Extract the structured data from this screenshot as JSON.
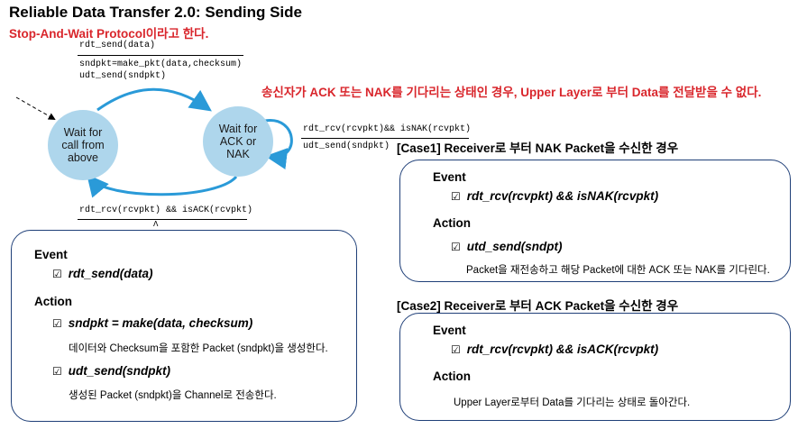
{
  "title": "Reliable Data Transfer 2.0: Sending Side",
  "subtitle": "Stop-And-Wait Protocol이라고 한다.",
  "note": "송신자가 ACK 또는 NAK를 기다리는 상태인 경우, Upper Layer로 부터 Data를 전달받을 수 없다.",
  "fsm": {
    "state1": "Wait for\ncall from\nabove",
    "state2": "Wait for\nACK or\nNAK",
    "t1_event": "rdt_send(data)",
    "t1_action1": "sndpkt=make_pkt(data,checksum)",
    "t1_action2": "udt_send(sndpkt)",
    "self_event": "rdt_rcv(rcvpkt)&& isNAK(rcvpkt)",
    "self_action": "udt_send(sndpkt)",
    "back_event": "rdt_rcv(rcvpkt) && isACK(rcvpkt)",
    "back_action": "Λ"
  },
  "left_box": {
    "event_heading": "Event",
    "event_item": "rdt_send(data)",
    "action_heading": "Action",
    "action1": "sndpkt = make(data, checksum)",
    "action1_desc": "데이터와 Checksum을 포함한 Packet (sndpkt)을 생성한다.",
    "action2": "udt_send(sndpkt)",
    "action2_desc": "생성된 Packet (sndpkt)을 Channel로 전송한다."
  },
  "case1": {
    "title": "[Case1] Receiver로 부터 NAK Packet을 수신한 경우",
    "event_heading": "Event",
    "event_item": "rdt_rcv(rcvpkt) && isNAK(rcvpkt)",
    "action_heading": "Action",
    "action1": "utd_send(sndpt)",
    "action1_desc": "Packet을 재전송하고 해당 Packet에 대한 ACK 또는 NAK를 기다린다."
  },
  "case2": {
    "title": "[Case2] Receiver로 부터 ACK Packet을 수신한 경우",
    "event_heading": "Event",
    "event_item": "rdt_rcv(rcvpkt) && isACK(rcvpkt)",
    "action_heading": "Action",
    "action_desc": "Upper Layer로부터 Data를 기다리는 상태로 돌아간다."
  },
  "check_symbol": "☑",
  "colors": {
    "accent_red": "#d9262c",
    "state_fill": "#aed6ec",
    "arrow_blue": "#2a9ad8",
    "box_border": "#1f3f78"
  }
}
